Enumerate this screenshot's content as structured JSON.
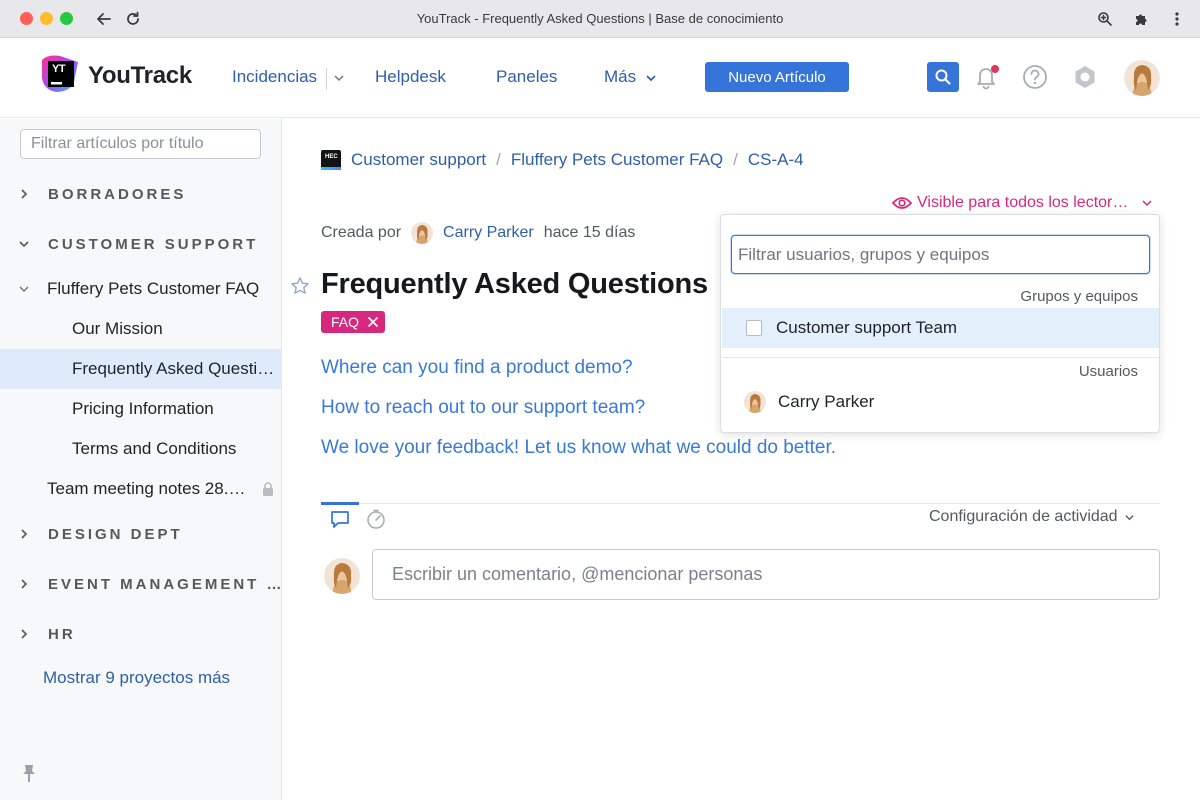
{
  "window": {
    "title": "YouTrack - Frequently Asked Questions | Base de conocimiento"
  },
  "header": {
    "logo_text": "YouTrack",
    "logo_mark": "YT",
    "nav": [
      "Incidencias",
      "Helpdesk",
      "Paneles",
      "Más"
    ],
    "new_article": "Nuevo Artículo"
  },
  "sidebar": {
    "filter_placeholder": "Filtrar artículos por título",
    "projects": {
      "drafts": "BORRADORES",
      "customer_support": "CUSTOMER SUPPORT",
      "design": "DESIGN DEPT",
      "events": "EVENT MANAGEMENT …",
      "hr": "HR"
    },
    "articles": {
      "faq_parent": "Fluffery Pets Customer FAQ",
      "mission": "Our Mission",
      "faq": "Frequently Asked Questions",
      "pricing": "Pricing Information",
      "terms": "Terms and Conditions",
      "meeting": "Team meeting notes 28.…"
    },
    "show_more": "Mostrar 9 proyectos más"
  },
  "breadcrumb": {
    "logo": "HEC",
    "items": [
      "Customer support",
      "Fluffery Pets Customer FAQ",
      "CS-A-4"
    ]
  },
  "visibility": "Visible para todos los lector…",
  "meta": {
    "created_by": "Creada por",
    "author": "Carry Parker",
    "time": "hace 15 días"
  },
  "article": {
    "title": "Frequently Asked Questions",
    "tag": "FAQ",
    "links": [
      "Where can you find a product demo?",
      "How to reach out to our support team?",
      "We love your feedback! Let us know what we could do better."
    ]
  },
  "activity": {
    "settings": "Configuración de actividad",
    "comment_placeholder": "Escribir un comentario, @mencionar personas"
  },
  "dropdown": {
    "filter_placeholder": "Filtrar usuarios, grupos y equipos",
    "groups_header": "Grupos y equipos",
    "group_item": "Customer support Team",
    "users_header": "Usuarios",
    "user_item": "Carry Parker"
  },
  "colors": {
    "accent": "#3574d9",
    "link": "#2e5fa8",
    "tag": "#d6287f",
    "active_row": "#dfebfb"
  }
}
